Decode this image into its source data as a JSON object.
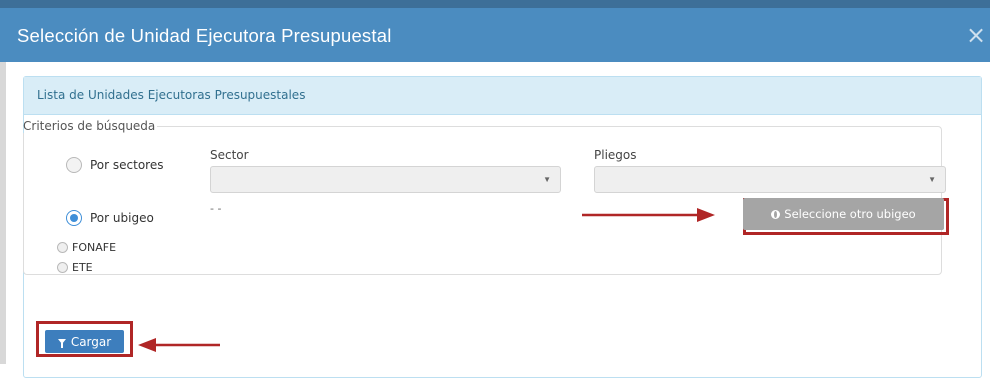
{
  "dialog": {
    "title": "Selección de Unidad Ejecutora Presupuestal",
    "close_glyph": "×",
    "close_icon": "close-icon"
  },
  "panel": {
    "heading": "Lista de Unidades Ejecutoras Presupuestales"
  },
  "criteria": {
    "legend": "Criterios de búsqueda",
    "options": [
      {
        "label": "Por sectores",
        "selected": false
      },
      {
        "label": "Por ubigeo",
        "selected": true
      },
      {
        "label": "FONAFE",
        "selected": false
      },
      {
        "label": "ETE",
        "selected": false
      }
    ],
    "sector": {
      "label": "Sector",
      "value": ""
    },
    "pliegos": {
      "label": "Pliegos",
      "value": ""
    },
    "ubigeo_value": "- -",
    "ubigeo_button": "Seleccione otro ubigeo",
    "ubigeo_icon": "globe-icon"
  },
  "actions": {
    "cargar_label": "Cargar",
    "cargar_icon": "filter-icon"
  },
  "annotations": {
    "highlight_color": "#b02626"
  },
  "colors": {
    "header": "#4b8cc0",
    "panel_heading_bg": "#d9edf7",
    "primary_button": "#3d7ebd",
    "disabled_button": "#a5a5a5"
  }
}
